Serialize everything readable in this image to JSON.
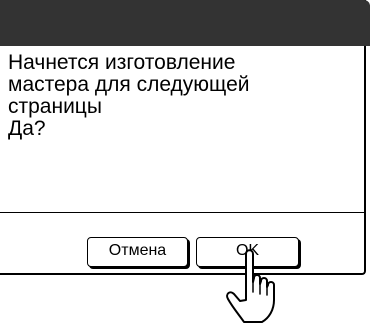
{
  "dialog": {
    "message": "Начнется изготовление\nмастера для следующей\nстраницы\nДа?",
    "cancel_label": "Отмена",
    "ok_label": "OK"
  },
  "colors": {
    "title_bar": "#333333",
    "border": "#000000",
    "background": "#ffffff"
  },
  "icons": {
    "pointer": "pointing-hand-icon"
  }
}
